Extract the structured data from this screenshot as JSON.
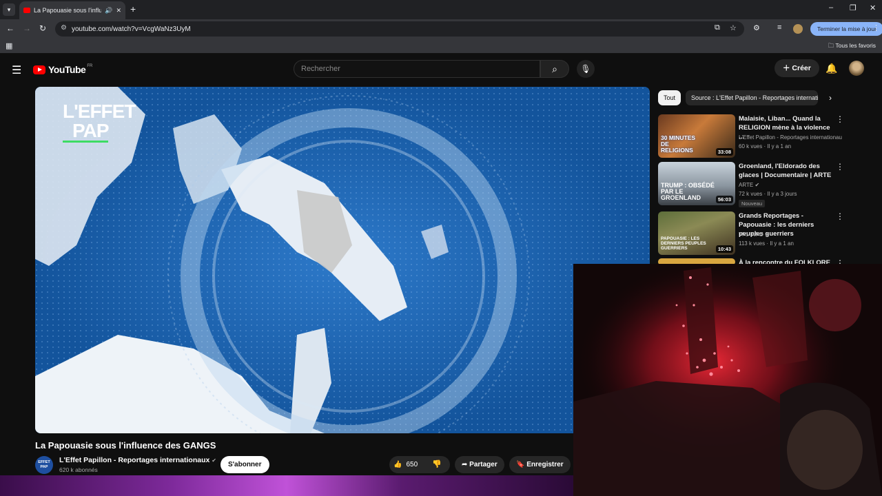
{
  "browser": {
    "tab_title": "La Papouasie sous l'influen",
    "url": "youtube.com/watch?v=VcgWaNz3UyM",
    "update_button": "Terminer la mise à jour",
    "bookmarks_folder": "Tous les favoris"
  },
  "youtube": {
    "logo": "YouTube",
    "logo_country": "FR",
    "search_placeholder": "Rechercher",
    "create_button": "Créer"
  },
  "video": {
    "watermark_line1": "L'EFFET",
    "watermark_line2": "PAP",
    "title": "La Papouasie sous l'influence des GANGS",
    "channel": "L'Effet Papillon - Reportages internationaux",
    "channel_avatar_text": "EFFET PAP",
    "subscribers": "620 k abonnés",
    "subscribe": "S'abonner",
    "likes": "650",
    "share": "Partager",
    "save": "Enregistrer"
  },
  "filters": {
    "all": "Tout",
    "source": "Source : L'Effet Papillon - Reportages internationaux"
  },
  "recommendations": [
    {
      "title": "Malaisie, Liban... Quand la RELIGION mène à la violence ...",
      "channel": "L'Effet Papillon - Reportages internationaux",
      "meta": "60 k vues · Il y a 1 an",
      "duration": "33:08",
      "thumb_text": "30 MINUTES DE RELIGIONS",
      "badge": ""
    },
    {
      "title": "Groenland, l'Eldorado des glaces | Documentaire | ARTE",
      "channel": "ARTE",
      "meta": "72 k vues · Il y a 3 jours",
      "duration": "56:03",
      "thumb_text": "TRUMP : OBSÉDÉ PAR LE GROENLAND",
      "badge": "Nouveau"
    },
    {
      "title": "Grands Reportages - Papouasie : les derniers peuples guerriers",
      "channel": "TF1 INFO",
      "meta": "113 k vues · Il y a 1 an",
      "duration": "10:43",
      "thumb_text": "PAPOUASIE : LES DERNIERS PEUPLES GUERRIERS",
      "badge": ""
    },
    {
      "title": "À la rencontre du FOLKLORE",
      "channel": "",
      "meta": "",
      "duration": "",
      "thumb_text": "",
      "badge": ""
    }
  ]
}
